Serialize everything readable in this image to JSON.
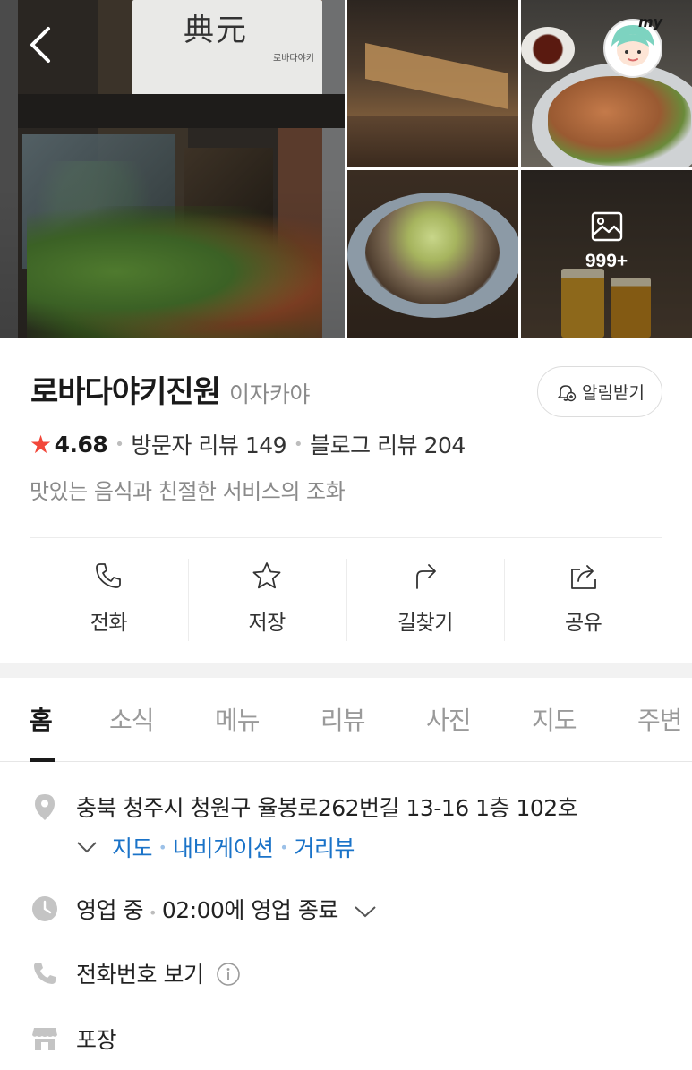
{
  "photos": {
    "more_count": "999+"
  },
  "place": {
    "name": "로바다야키진원",
    "category": "이자카야",
    "alarm_label": "알림받기",
    "rating": "4.68",
    "visitor_reviews": "방문자 리뷰 149",
    "blog_reviews": "블로그 리뷰 204",
    "description": "맛있는 음식과 친절한 서비스의 조화"
  },
  "actions": [
    {
      "label": "전화",
      "icon": "phone-icon"
    },
    {
      "label": "저장",
      "icon": "star-icon"
    },
    {
      "label": "길찾기",
      "icon": "directions-icon"
    },
    {
      "label": "공유",
      "icon": "share-icon"
    }
  ],
  "tabs": [
    "홈",
    "소식",
    "메뉴",
    "리뷰",
    "사진",
    "지도",
    "주변"
  ],
  "active_tab": "홈",
  "info": {
    "address": "충북 청주시 청원구 율봉로262번길 13-16 1층 102호",
    "address_links": [
      "지도",
      "내비게이션",
      "거리뷰"
    ],
    "hours_status": "영업 중",
    "hours_detail": "02:00에 영업 종료",
    "phone_label": "전화번호 보기",
    "service": "포장"
  },
  "colors": {
    "accent_link": "#1a73c8",
    "star": "#f2473a"
  }
}
